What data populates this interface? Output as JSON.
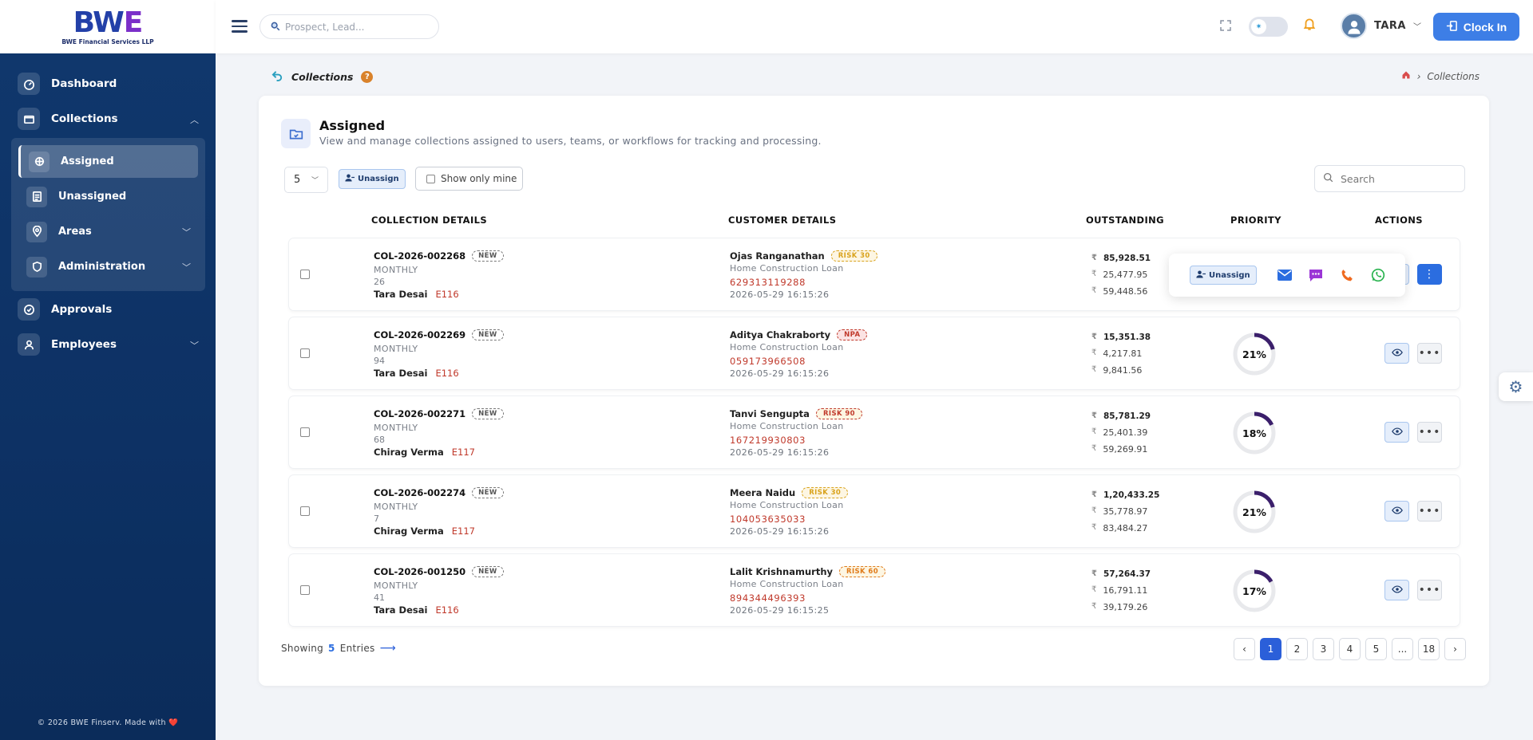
{
  "brand": {
    "logo_text": "BWE",
    "company": "BWE Financial Services LLP"
  },
  "sidebar": {
    "dashboard": "Dashboard",
    "collections": "Collections",
    "sub": [
      {
        "label": "Assigned"
      },
      {
        "label": "Unassigned"
      },
      {
        "label": "Areas"
      },
      {
        "label": "Administration"
      }
    ],
    "approvals": "Approvals",
    "employees": "Employees",
    "footer": "© 2026 BWE Finserv. Made with ❤️"
  },
  "topbar": {
    "search_placeholder": "Prospect, Lead...",
    "user": "TARA",
    "clock_in": "Clock In"
  },
  "page": {
    "title": "Collections",
    "breadcrumb": "Collections"
  },
  "card": {
    "title": "Assigned",
    "description": "View and manage collections assigned to users, teams, or workflows for tracking and processing.",
    "per_page": "5",
    "unassign": "Unassign",
    "show_mine": "Show only mine",
    "search_placeholder": "Search",
    "headers": {
      "collection": "COLLECTION DETAILS",
      "customer": "CUSTOMER DETAILS",
      "outstanding": "OUTSTANDING",
      "priority": "PRIORITY",
      "actions": "ACTIONS"
    }
  },
  "rows": [
    {
      "id": "COL-2026-002268",
      "tag": "NEW",
      "freq": "MONTHLY",
      "num": "26",
      "agent": "Tara Desai",
      "code": "E116",
      "customer": "Ojas Ranganathan",
      "risk": "RISK 30",
      "risk_color": "#d9a21b",
      "loan": "Home Construction Loan",
      "account": "629313119288",
      "date": "2026-05-29 16:15:26",
      "amt_total": "85,928.51",
      "amt_2": "25,477.95",
      "amt_3": "59,448.56",
      "priority": null,
      "priority_label": ""
    },
    {
      "id": "COL-2026-002269",
      "tag": "NEW",
      "freq": "MONTHLY",
      "num": "94",
      "agent": "Tara Desai",
      "code": "E116",
      "customer": "Aditya Chakraborty",
      "risk": "NPA",
      "risk_color": "#c0392b",
      "loan": "Home Construction Loan",
      "account": "059173966508",
      "date": "2026-05-29 16:15:26",
      "amt_total": "15,351.38",
      "amt_2": "4,217.81",
      "amt_3": "9,841.56",
      "priority": 21,
      "priority_label": "21%"
    },
    {
      "id": "COL-2026-002271",
      "tag": "NEW",
      "freq": "MONTHLY",
      "num": "68",
      "agent": "Chirag Verma",
      "code": "E117",
      "customer": "Tanvi Sengupta",
      "risk": "RISK 90",
      "risk_color": "#c0392b",
      "loan": "Home Construction Loan",
      "account": "167219930803",
      "date": "2026-05-29 16:15:26",
      "amt_total": "85,781.29",
      "amt_2": "25,401.39",
      "amt_3": "59,269.91",
      "priority": 18,
      "priority_label": "18%"
    },
    {
      "id": "COL-2026-002274",
      "tag": "NEW",
      "freq": "MONTHLY",
      "num": "7",
      "agent": "Chirag Verma",
      "code": "E117",
      "customer": "Meera Naidu",
      "risk": "RISK 30",
      "risk_color": "#d9a21b",
      "loan": "Home Construction Loan",
      "account": "104053635033",
      "date": "2026-05-29 16:15:26",
      "amt_total": "1,20,433.25",
      "amt_2": "35,778.97",
      "amt_3": "83,484.27",
      "priority": 21,
      "priority_label": "21%"
    },
    {
      "id": "COL-2026-001250",
      "tag": "NEW",
      "freq": "MONTHLY",
      "num": "41",
      "agent": "Tara Desai",
      "code": "E116",
      "customer": "Lalit Krishnamurthy",
      "risk": "RISK 60",
      "risk_color": "#e07b1a",
      "loan": "Home Construction Loan",
      "account": "894344496393",
      "date": "2026-05-29 16:15:25",
      "amt_total": "57,264.37",
      "amt_2": "16,791.11",
      "amt_3": "39,179.26",
      "priority": 17,
      "priority_label": "17%"
    }
  ],
  "popover": {
    "unassign": "Unassign",
    "icons": [
      "mail-icon",
      "sms-icon",
      "phone-icon",
      "whatsapp-icon"
    ]
  },
  "footer_table": {
    "showing": "Showing",
    "count": "5",
    "entries": "Entries"
  },
  "pagination": {
    "pages": [
      "1",
      "2",
      "3",
      "4",
      "5",
      "...",
      "18"
    ],
    "current": "1"
  },
  "colors": {
    "sidebar": "#0d3164",
    "accent": "#2b6de0",
    "priority": "#3b1f6b"
  }
}
